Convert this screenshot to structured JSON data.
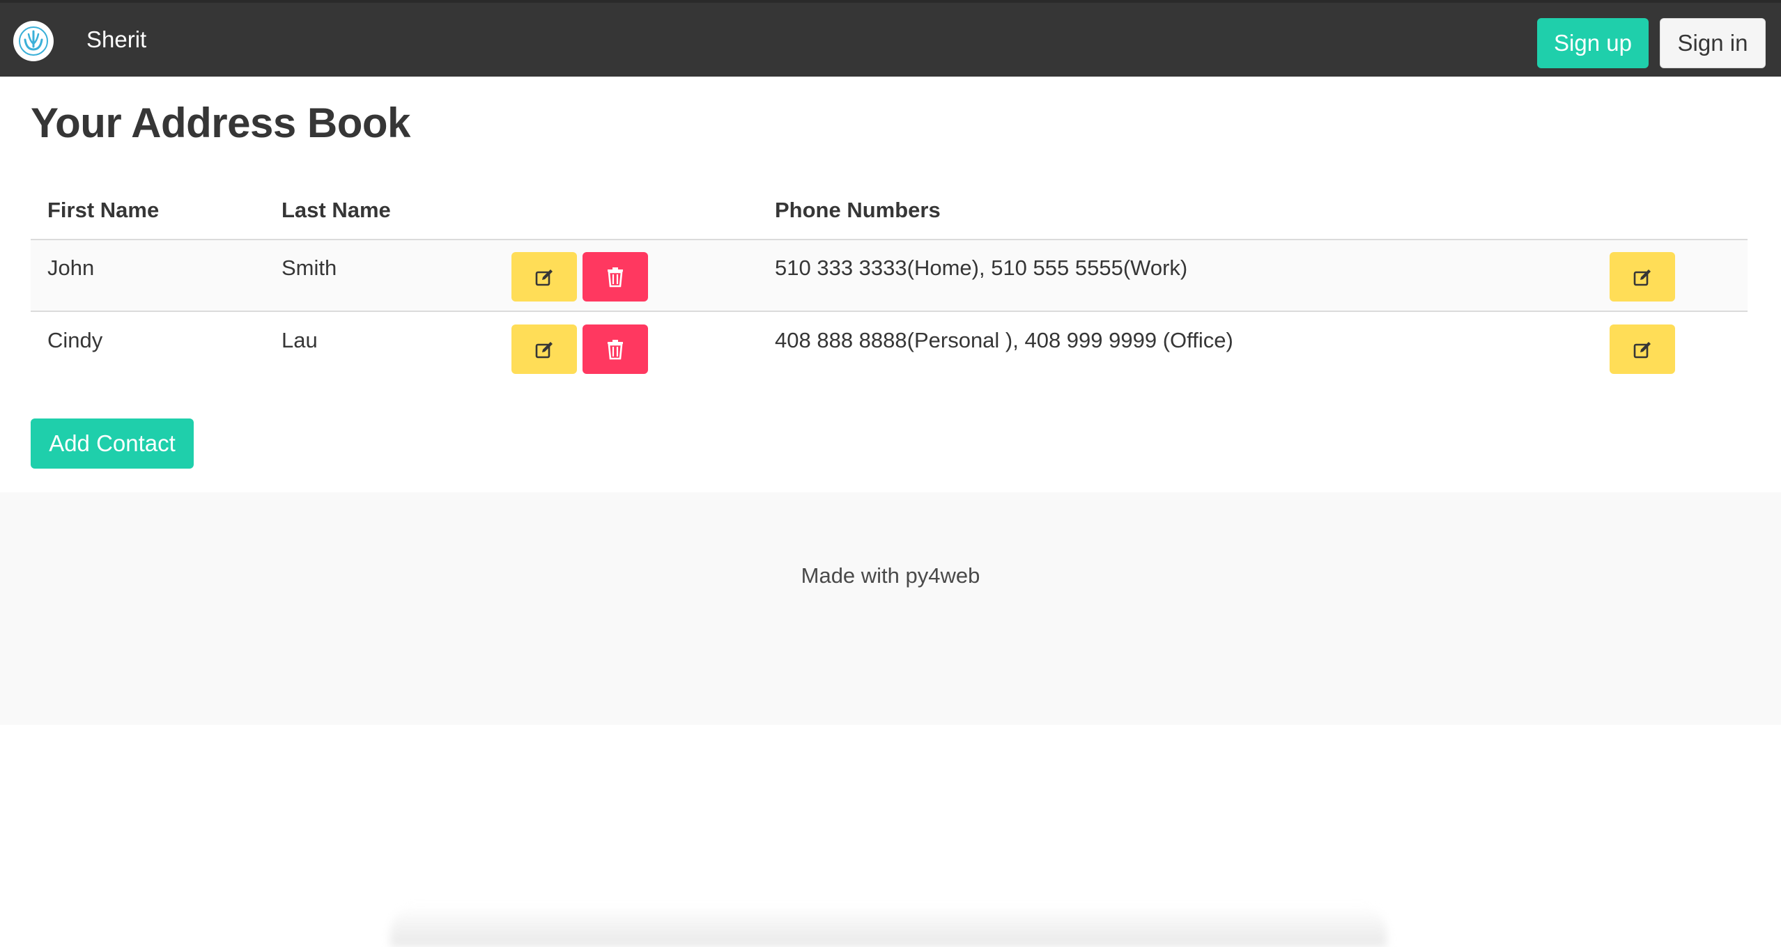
{
  "navbar": {
    "logo_icon": "sherit-logo-icon",
    "brand": "Sherit",
    "signup_label": "Sign up",
    "signin_label": "Sign in",
    "bg_color": "#363636",
    "primary_color": "#1fcfab"
  },
  "main": {
    "title": "Your Address Book",
    "table": {
      "headers": [
        "First Name",
        "Last Name",
        "",
        "Phone Numbers",
        ""
      ],
      "rows": [
        {
          "first_name": "John",
          "last_name": "Smith",
          "phones": "510 333 3333(Home), 510 555 5555(Work)"
        },
        {
          "first_name": "Cindy",
          "last_name": "Lau",
          "phones": "408 888 8888(Personal ), 408 999 9999 (Office)"
        }
      ],
      "edit_icon": "edit-icon",
      "delete_icon": "trash-icon",
      "edit_color": "#ffdd57",
      "delete_color": "#ff3860"
    },
    "add_contact_label": "Add Contact"
  },
  "footer": {
    "text": "Made with py4web"
  }
}
